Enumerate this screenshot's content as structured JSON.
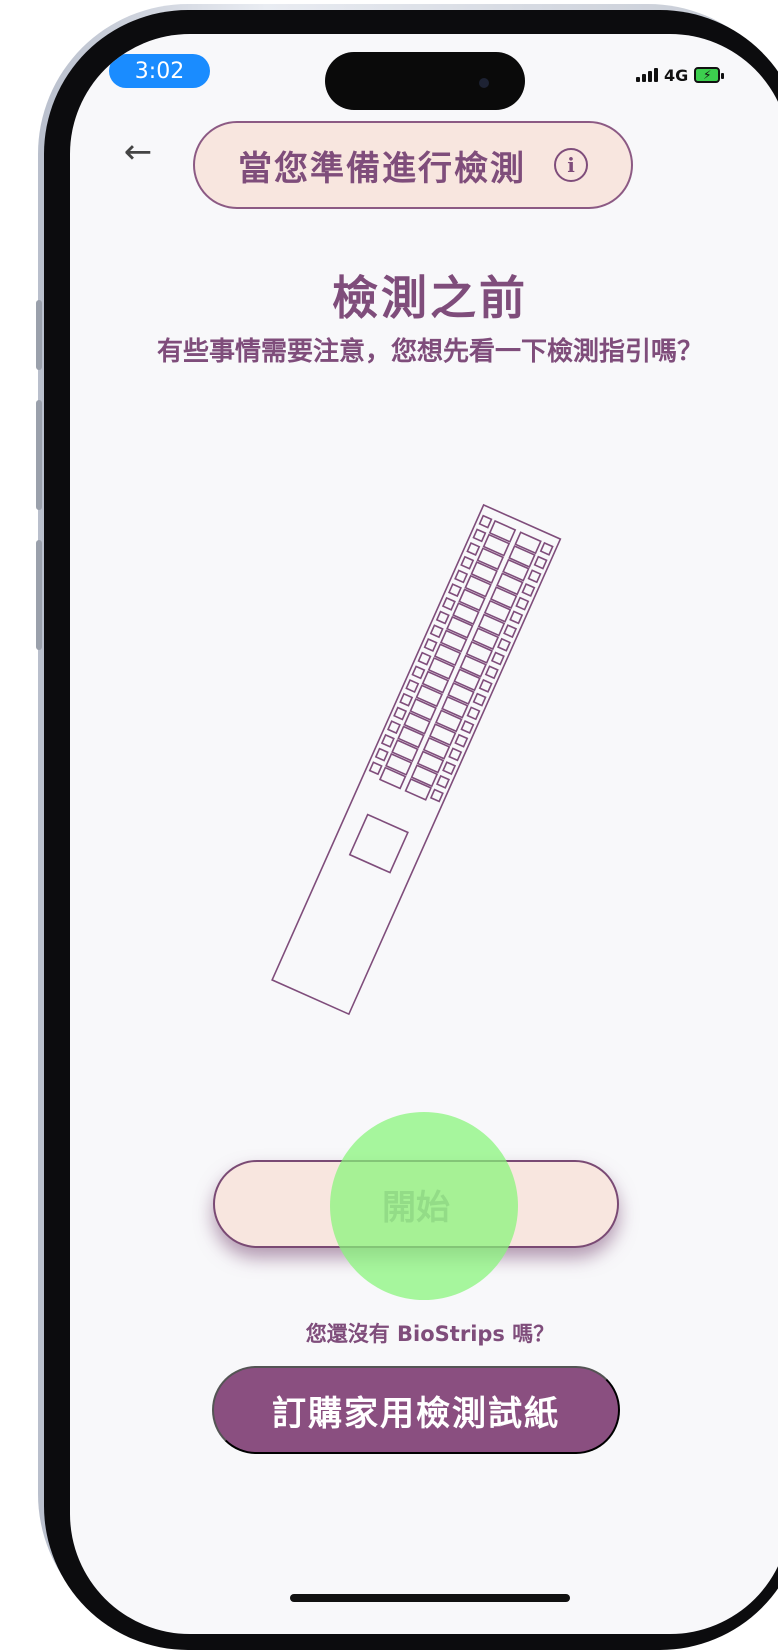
{
  "status_bar": {
    "time": "3:02",
    "network": "4G"
  },
  "header": {
    "title": "當您準備進行檢測",
    "info_icon": "info-icon",
    "back_icon": "arrow-left-icon"
  },
  "main": {
    "title": "檢測之前",
    "subtitle": "有些事情需要注意，您想先看一下檢測指引嗎？",
    "start_label": "開始",
    "no_strips_text": "您還沒有 BioStrips 嗎？",
    "order_label": "訂購家用檢測試紙"
  },
  "colors": {
    "accent": "#8a4f80",
    "pill_bg": "#f8e6df",
    "time_badge": "#1a8cff"
  }
}
